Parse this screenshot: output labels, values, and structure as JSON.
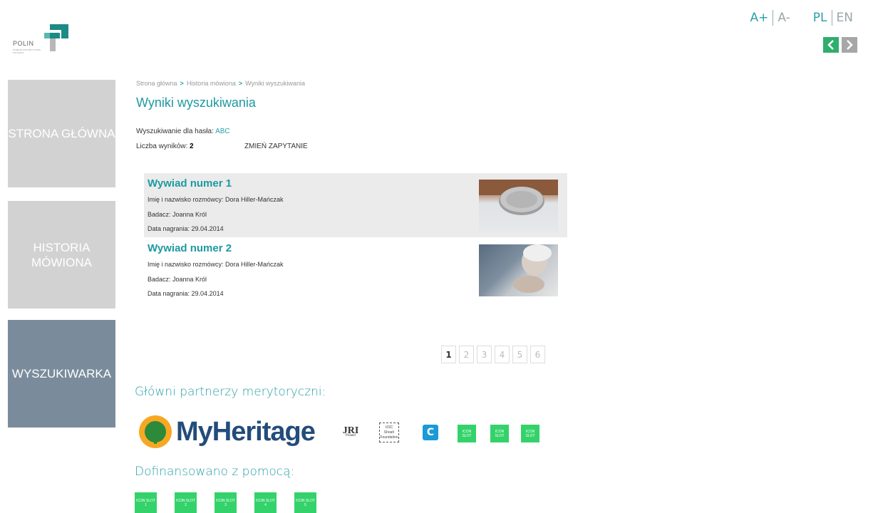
{
  "header": {
    "font_up": "A+",
    "font_down": "A-",
    "lang_pl": "PL",
    "lang_en": "EN",
    "prev": "<",
    "next": ">"
  },
  "logo": {
    "text": "POLIN",
    "sub": "MUZEUM HISTORII ŻYDÓW POLSKICH"
  },
  "sidebar": {
    "items": [
      {
        "label": "STRONA GŁÓWNA"
      },
      {
        "label": "HISTORIA MÓWIONA"
      },
      {
        "label": "WYSZUKIWARKA"
      }
    ]
  },
  "breadcrumb": {
    "items": [
      "Strona główna",
      "Historia mówiona",
      "Wyniki wyszukiwania"
    ],
    "sep": ">"
  },
  "page_title": "Wyniki wyszukiwania",
  "query": {
    "label": "Wyszukiwanie dla hasła:",
    "value": "ABC",
    "count_label": "Liczba wyników:",
    "count": "2",
    "change_label": "ZMIEŃ ZAPYTANIE"
  },
  "results": [
    {
      "title": "Wywiad numer 1",
      "interviewee": "Imię i nazwisko rozmówcy: Dora Hiller-Mańczak",
      "researcher": "Badacz: Joanna Król",
      "date": "Data nagrania: 29.04.2014"
    },
    {
      "title": "Wywiad numer 2",
      "interviewee": "Imię i nazwisko rozmówcy: Dora Hiller-Mańczak",
      "researcher": "Badacz: Joanna Król",
      "date": "Data nagrania: 29.04.2014"
    }
  ],
  "pagination": {
    "pages": [
      "1",
      "2",
      "3",
      "4",
      "5",
      "6"
    ],
    "current": "1"
  },
  "partners": {
    "heading": "Główni partnerzy merytoryczni:",
    "myheritage": "MyHeritage",
    "jri": "JRI",
    "jri_sub": "Poland",
    "usc": "USC Shoah Foundation",
    "c_logo": "C",
    "slots": [
      "ICON SLOT",
      "ICON SLOT",
      "ICON SLOT"
    ]
  },
  "funding": {
    "heading": "Dofinansowano z pomocą:",
    "slots": [
      "ICON SLOT 1",
      "ICON SLOT 2",
      "ICON SLOT 3",
      "ICON SLOT 4",
      "ICON SLOT 5"
    ]
  },
  "colors": {
    "accent": "#2aa0a8",
    "active_sidebar": "#7a8c9c",
    "sidebar": "#d2d2d2",
    "slot": "#34d26a"
  }
}
